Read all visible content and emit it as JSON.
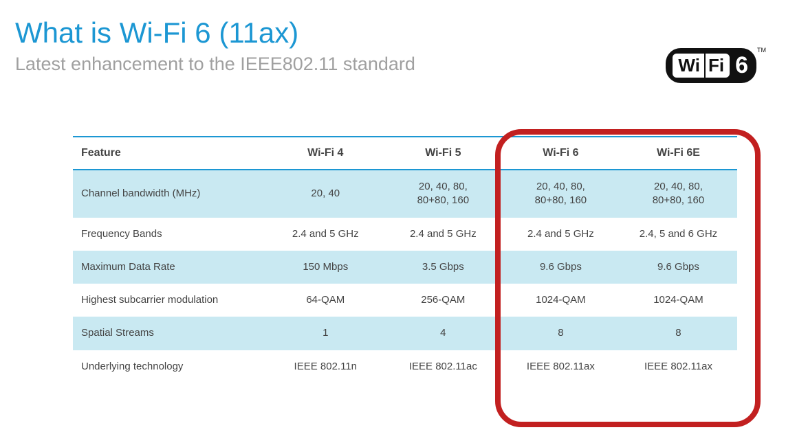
{
  "title": "What is Wi-Fi 6 (11ax)",
  "subtitle": "Latest enhancement to the IEEE802.11 standard",
  "logo": {
    "wi": "Wi",
    "fi": "Fi",
    "six": "6",
    "tm": "TM"
  },
  "table": {
    "headers": [
      "Feature",
      "Wi-Fi 4",
      "Wi-Fi 5",
      "Wi-Fi 6",
      "Wi-Fi 6E"
    ],
    "rows": [
      {
        "feature": "Channel bandwidth (MHz)",
        "c1": "20, 40",
        "c2": "20, 40, 80,\n80+80, 160",
        "c3": "20, 40, 80,\n80+80, 160",
        "c4": "20, 40, 80,\n80+80, 160"
      },
      {
        "feature": "Frequency Bands",
        "c1": "2.4 and 5 GHz",
        "c2": "2.4 and 5 GHz",
        "c3": "2.4 and 5 GHz",
        "c4": "2.4, 5 and 6 GHz"
      },
      {
        "feature": "Maximum Data Rate",
        "c1": "150 Mbps",
        "c2": "3.5 Gbps",
        "c3": "9.6 Gbps",
        "c4": "9.6 Gbps"
      },
      {
        "feature": "Highest subcarrier modulation",
        "c1": "64-QAM",
        "c2": "256-QAM",
        "c3": "1024-QAM",
        "c4": "1024-QAM"
      },
      {
        "feature": "Spatial Streams",
        "c1": "1",
        "c2": "4",
        "c3": "8",
        "c4": "8"
      },
      {
        "feature": "Underlying technology",
        "c1": "IEEE 802.11n",
        "c2": "IEEE 802.11ac",
        "c3": "IEEE 802.11ax",
        "c4": "IEEE 802.11ax"
      }
    ]
  }
}
